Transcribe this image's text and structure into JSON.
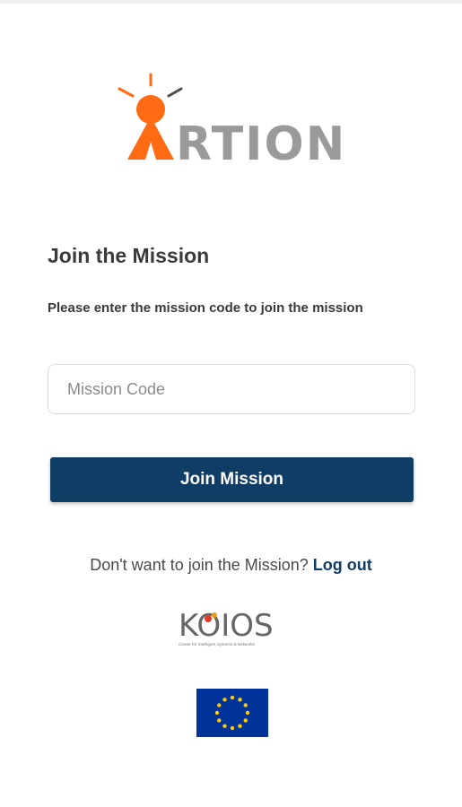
{
  "brand": {
    "logo_text": "RTION",
    "logo_colors": {
      "orange": "#ff6a13",
      "gray": "#9a9a9a"
    }
  },
  "page": {
    "title": "Join the Mission",
    "subtitle": "Please enter the mission code to join the mission"
  },
  "form": {
    "mission_code": {
      "value": "",
      "placeholder": "Mission Code"
    },
    "submit_label": "Join Mission",
    "button_color": "#0f3d66"
  },
  "logout": {
    "prompt": "Don't want to join the Mission?",
    "link_label": "Log out"
  },
  "partners": {
    "koios": {
      "logo_text": "KOIOS",
      "tagline": "Center for Intelligent Systems & Networks"
    },
    "eu_flag_color": "#003399",
    "eu_star_color": "#ffcc00"
  }
}
